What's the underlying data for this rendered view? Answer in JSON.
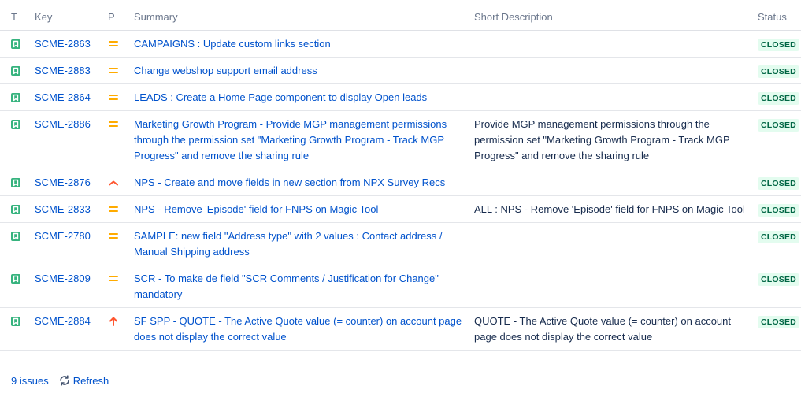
{
  "columns": {
    "type": "T",
    "key": "Key",
    "priority": "P",
    "summary": "Summary",
    "short_description": "Short Description",
    "status": "Status"
  },
  "issues": [
    {
      "key": "SCME-2863",
      "priority": "medium",
      "summary": "CAMPAIGNS : Update custom links section",
      "description": "",
      "status": "CLOSED"
    },
    {
      "key": "SCME-2883",
      "priority": "medium",
      "summary": "Change webshop support email address",
      "description": "",
      "status": "CLOSED"
    },
    {
      "key": "SCME-2864",
      "priority": "medium",
      "summary": "LEADS : Create a Home Page component to display Open leads",
      "description": "",
      "status": "CLOSED"
    },
    {
      "key": "SCME-2886",
      "priority": "medium",
      "summary": "Marketing Growth Program - Provide MGP management permissions through the permission set \"Marketing Growth Program - Track MGP Progress\" and remove the sharing rule",
      "description": "Provide MGP management permissions through the permission set \"Marketing Growth Program - Track MGP Progress\" and remove the sharing rule",
      "status": "CLOSED"
    },
    {
      "key": "SCME-2876",
      "priority": "high",
      "summary": "NPS - Create and move fields in new section from NPX Survey Recs",
      "description": "",
      "status": "CLOSED"
    },
    {
      "key": "SCME-2833",
      "priority": "medium",
      "summary": "NPS - Remove 'Episode' field for FNPS on Magic Tool",
      "description": "ALL : NPS - Remove 'Episode' field for FNPS on Magic Tool",
      "status": "CLOSED"
    },
    {
      "key": "SCME-2780",
      "priority": "medium",
      "summary": "SAMPLE: new field \"Address type\" with 2 values : Contact address / Manual Shipping address",
      "description": "",
      "status": "CLOSED"
    },
    {
      "key": "SCME-2809",
      "priority": "medium",
      "summary": "SCR - To make de field \"SCR Comments / Justification for Change\" mandatory",
      "description": "",
      "status": "CLOSED"
    },
    {
      "key": "SCME-2884",
      "priority": "highest",
      "summary": "SF SPP - QUOTE - The Active Quote value (= counter) on account page does not display the correct value",
      "description": "QUOTE - The Active Quote value (= counter) on account page does not display the correct value",
      "status": "CLOSED"
    }
  ],
  "footer": {
    "count": "9 issues",
    "refresh_label": "Refresh"
  },
  "colors": {
    "link": "#0052cc",
    "story_icon": "#36b37e",
    "priority_medium": "#ffab00",
    "priority_high": "#ff5630",
    "priority_highest": "#ff5630",
    "status_bg": "#e3fcef",
    "status_text": "#006644"
  }
}
